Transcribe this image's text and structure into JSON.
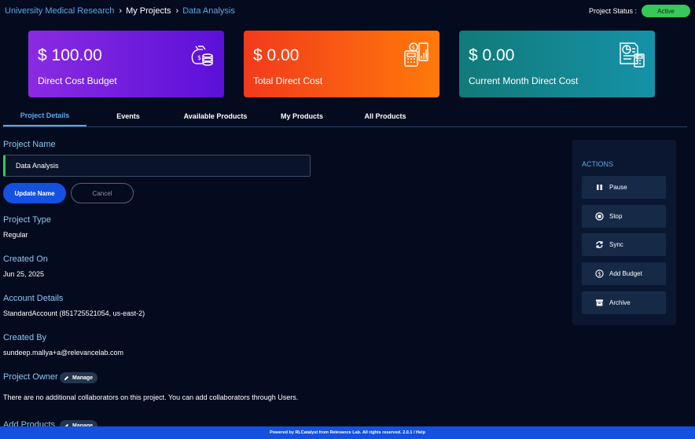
{
  "breadcrumb": {
    "root": "University Medical Research",
    "middle": "My Projects",
    "current": "Data Analysis"
  },
  "status": {
    "label": "Project Status :",
    "value": "Active",
    "color": "#37c85a"
  },
  "cards": [
    {
      "value": "$ 100.00",
      "label": "Direct Cost Budget",
      "icon": "money-bag-icon"
    },
    {
      "value": "$ 0.00",
      "label": "Total Direct Cost",
      "icon": "calculator-icon"
    },
    {
      "value": "$ 0.00",
      "label": "Current Month Direct Cost",
      "icon": "report-icon"
    }
  ],
  "tabs": [
    "Project Details",
    "Events",
    "Available Products",
    "My Products",
    "All Products"
  ],
  "details": {
    "name_label": "Project Name",
    "name_value": "Data Analysis",
    "update_label": "Update Name",
    "cancel_label": "Cancel",
    "type_label": "Project Type",
    "type_value": "Regular",
    "created_on_label": "Created On",
    "created_on_value": "Jun 25, 2025",
    "account_label": "Account Details",
    "account_value": "StandardAccount (851725521054, us-east-2)",
    "created_by_label": "Created By",
    "created_by_value": "sundeep.mallya+a@relevancelab.com",
    "owner_label": "Project Owner",
    "manage_label": "Manage",
    "collaborators_text": "There are no additional collaborators on this project. You can add collaborators through Users.",
    "add_products_label": "Add Products"
  },
  "actions": {
    "title": "ACTIONS",
    "items": [
      {
        "label": "Pause",
        "icon": "pause-icon"
      },
      {
        "label": "Stop",
        "icon": "stop-icon"
      },
      {
        "label": "Sync",
        "icon": "sync-icon"
      },
      {
        "label": "Add Budget",
        "icon": "dollar-circle-icon"
      },
      {
        "label": "Archive",
        "icon": "archive-icon"
      }
    ]
  },
  "footer": {
    "text": "Powered by RLCatalyst from Relevance Lab. All rights reserved. 2.0.1 / Help"
  },
  "colors": {
    "accent": "#5aa9e6",
    "primary_button": "#1551e0",
    "background": "#050b1f"
  }
}
